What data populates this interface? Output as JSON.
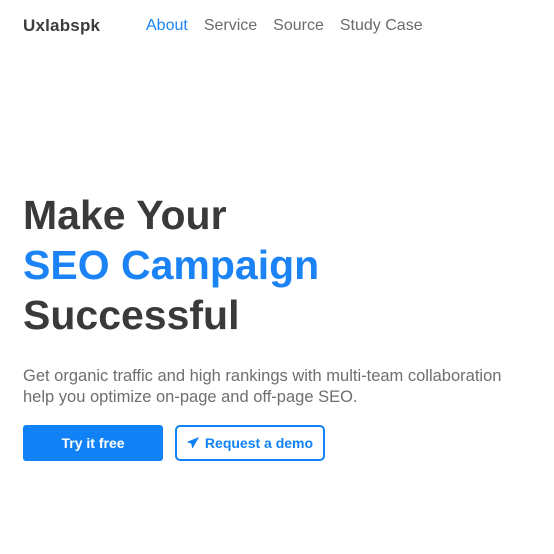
{
  "header": {
    "brand": "Uxlabspk",
    "nav": [
      {
        "label": "About",
        "active": true
      },
      {
        "label": "Service",
        "active": false
      },
      {
        "label": "Source",
        "active": false
      },
      {
        "label": "Study Case",
        "active": false
      }
    ]
  },
  "hero": {
    "title_line1": "Make Your",
    "title_line2": "SEO Campaign",
    "title_line3": "Successful",
    "subtitle_line1": "Get organic traffic and high rankings with multi-team collaboration",
    "subtitle_line2": "help you optimize on-page and off-page SEO.",
    "primary_button": "Try it free",
    "secondary_button": "Request a demo",
    "secondary_icon": "paper-plane-icon"
  },
  "colors": {
    "accent": "#1b83f5",
    "text_dark": "#3a3a3a",
    "text_muted": "#6e6e6e"
  }
}
